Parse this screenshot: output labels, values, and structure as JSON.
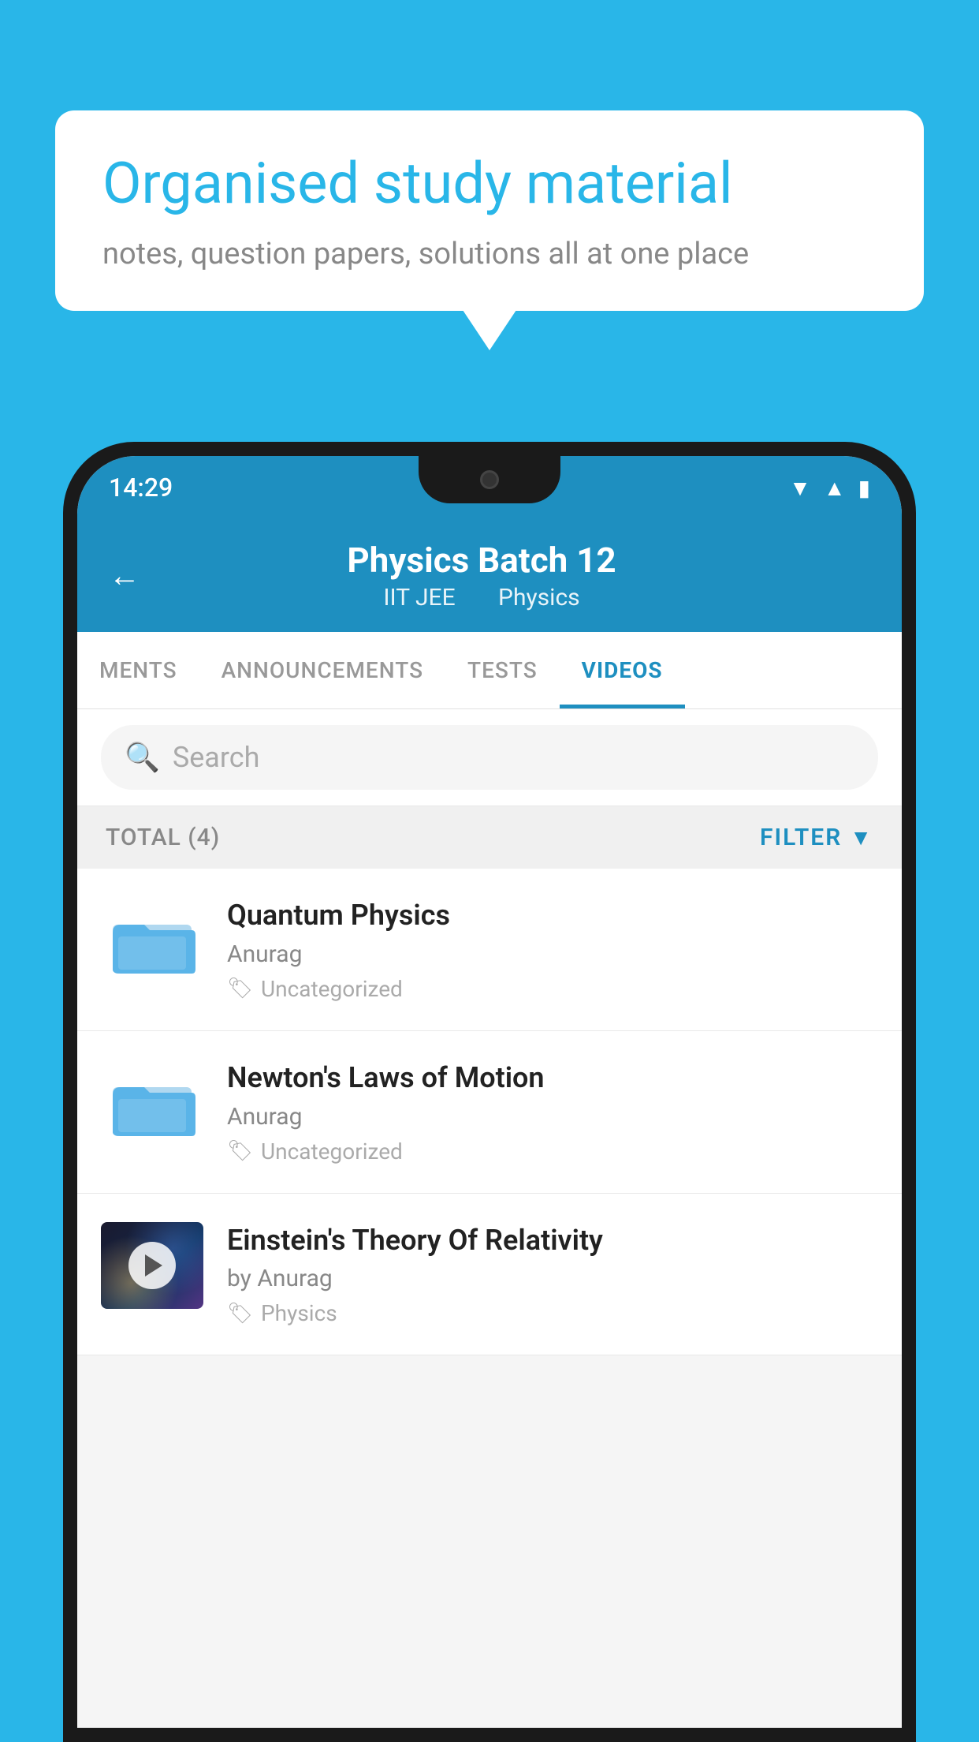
{
  "background_color": "#29b6e8",
  "speech_bubble": {
    "title": "Organised study material",
    "subtitle": "notes, question papers, solutions all at one place"
  },
  "status_bar": {
    "time": "14:29",
    "icons": [
      "wifi",
      "signal",
      "battery"
    ]
  },
  "header": {
    "back_label": "←",
    "title": "Physics Batch 12",
    "subtitle_parts": [
      "IIT JEE",
      "Physics"
    ]
  },
  "tabs": [
    {
      "label": "MENTS",
      "active": false
    },
    {
      "label": "ANNOUNCEMENTS",
      "active": false
    },
    {
      "label": "TESTS",
      "active": false
    },
    {
      "label": "VIDEOS",
      "active": true
    }
  ],
  "search": {
    "placeholder": "Search"
  },
  "filter_bar": {
    "total_label": "TOTAL (4)",
    "filter_label": "FILTER"
  },
  "videos": [
    {
      "title": "Quantum Physics",
      "author": "Anurag",
      "tag": "Uncategorized",
      "type": "folder",
      "thumbnail": null
    },
    {
      "title": "Newton's Laws of Motion",
      "author": "Anurag",
      "tag": "Uncategorized",
      "type": "folder",
      "thumbnail": null
    },
    {
      "title": "Einstein's Theory Of Relativity",
      "author": "by Anurag",
      "tag": "Physics",
      "type": "video",
      "thumbnail": "space"
    }
  ]
}
